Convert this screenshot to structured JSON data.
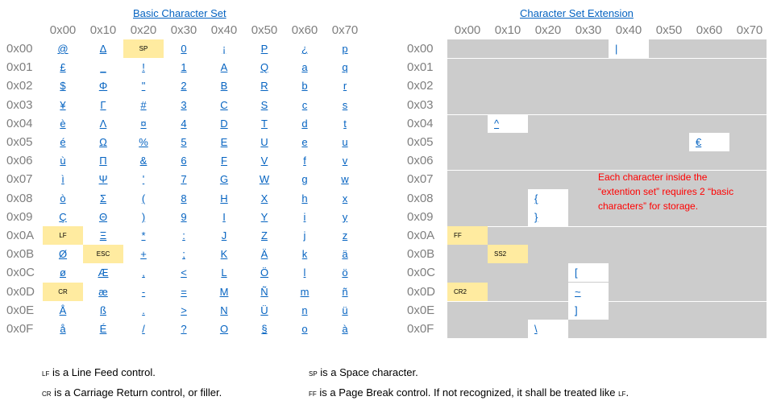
{
  "basic": {
    "title": "Basic Character Set",
    "columns": [
      "0x00",
      "0x10",
      "0x20",
      "0x30",
      "0x40",
      "0x50",
      "0x60",
      "0x70"
    ],
    "rows": [
      "0x00",
      "0x01",
      "0x02",
      "0x03",
      "0x04",
      "0x05",
      "0x06",
      "0x07",
      "0x08",
      "0x09",
      "0x0A",
      "0x0B",
      "0x0C",
      "0x0D",
      "0x0E",
      "0x0F"
    ],
    "cells": [
      [
        "@",
        "Δ",
        "SP",
        "0",
        "¡",
        "P",
        "¿",
        "p"
      ],
      [
        "£",
        "_",
        "!",
        "1",
        "A",
        "Q",
        "a",
        "q"
      ],
      [
        "$",
        "Φ",
        "\"",
        "2",
        "B",
        "R",
        "b",
        "r"
      ],
      [
        "¥",
        "Γ",
        "#",
        "3",
        "C",
        "S",
        "c",
        "s"
      ],
      [
        "è",
        "Λ",
        "¤",
        "4",
        "D",
        "T",
        "d",
        "t"
      ],
      [
        "é",
        "Ω",
        "%",
        "5",
        "E",
        "U",
        "e",
        "u"
      ],
      [
        "ù",
        "Π",
        "&",
        "6",
        "F",
        "V",
        "f",
        "v"
      ],
      [
        "ì",
        "Ψ",
        "'",
        "7",
        "G",
        "W",
        "g",
        "w"
      ],
      [
        "ò",
        "Σ",
        "(",
        "8",
        "H",
        "X",
        "h",
        "x"
      ],
      [
        "Ç",
        "Θ",
        ")",
        "9",
        "I",
        "Y",
        "i",
        "y"
      ],
      [
        "LF",
        "Ξ",
        "*",
        ":",
        "J",
        "Z",
        "j",
        "z"
      ],
      [
        "Ø",
        "ESC",
        "+",
        ";",
        "K",
        "Ä",
        "k",
        "ä"
      ],
      [
        "ø",
        "Æ",
        ",",
        "<",
        "L",
        "Ö",
        "l",
        "ö"
      ],
      [
        "CR",
        "æ",
        "-",
        "=",
        "M",
        "Ñ",
        "m",
        "ñ"
      ],
      [
        "Å",
        "ß",
        ".",
        ">",
        "N",
        "Ü",
        "n",
        "ü"
      ],
      [
        "å",
        "É",
        "/",
        "?",
        "O",
        "§",
        "o",
        "à"
      ]
    ],
    "control_cells": [
      "SP",
      "LF",
      "ESC",
      "CR"
    ]
  },
  "extension": {
    "title": "Character Set Extension",
    "columns": [
      "0x00",
      "0x10",
      "0x20",
      "0x30",
      "0x40",
      "0x50",
      "0x60",
      "0x70"
    ],
    "rows": [
      "0x00",
      "0x01",
      "0x02",
      "0x03",
      "0x04",
      "0x05",
      "0x06",
      "0x07",
      "0x08",
      "0x09",
      "0x0A",
      "0x0B",
      "0x0C",
      "0x0D",
      "0x0E",
      "0x0F"
    ],
    "entries": [
      {
        "row": 0,
        "col": 4,
        "char": "|",
        "control": false
      },
      {
        "row": 4,
        "col": 1,
        "char": "^",
        "control": false
      },
      {
        "row": 5,
        "col": 6,
        "char": "€",
        "control": false
      },
      {
        "row": 8,
        "col": 2,
        "char": "{",
        "control": false
      },
      {
        "row": 9,
        "col": 2,
        "char": "}",
        "control": false
      },
      {
        "row": 10,
        "col": 0,
        "char": "FF",
        "control": true
      },
      {
        "row": 11,
        "col": 1,
        "char": "SS2",
        "control": true
      },
      {
        "row": 12,
        "col": 3,
        "char": "[",
        "control": false
      },
      {
        "row": 13,
        "col": 0,
        "char": "CR2",
        "control": true
      },
      {
        "row": 13,
        "col": 3,
        "char": "~",
        "control": false
      },
      {
        "row": 14,
        "col": 3,
        "char": "]",
        "control": false
      },
      {
        "row": 15,
        "col": 2,
        "char": "\\",
        "control": false
      }
    ],
    "note": "Each character inside the “extention set” requires 2 “basic characters” for storage."
  },
  "footnotes": [
    {
      "abbr": "LF",
      "text": " is a Line Feed control.",
      "tail": ""
    },
    {
      "abbr": "CR",
      "text": " is a Carriage Return control, or filler.",
      "tail": ""
    },
    {
      "abbr": "SP",
      "text": " is a Space character.",
      "tail": ""
    },
    {
      "abbr": "FF",
      "text": " is a Page Break control. If not recognized, it shall be treated like ",
      "tail": "LF"
    }
  ],
  "colors": {
    "link": "#0563c1",
    "header": "#7f7f7f",
    "control_fill": "#ffeba0",
    "ext_fill": "#cccccc",
    "note": "#ff0000"
  }
}
